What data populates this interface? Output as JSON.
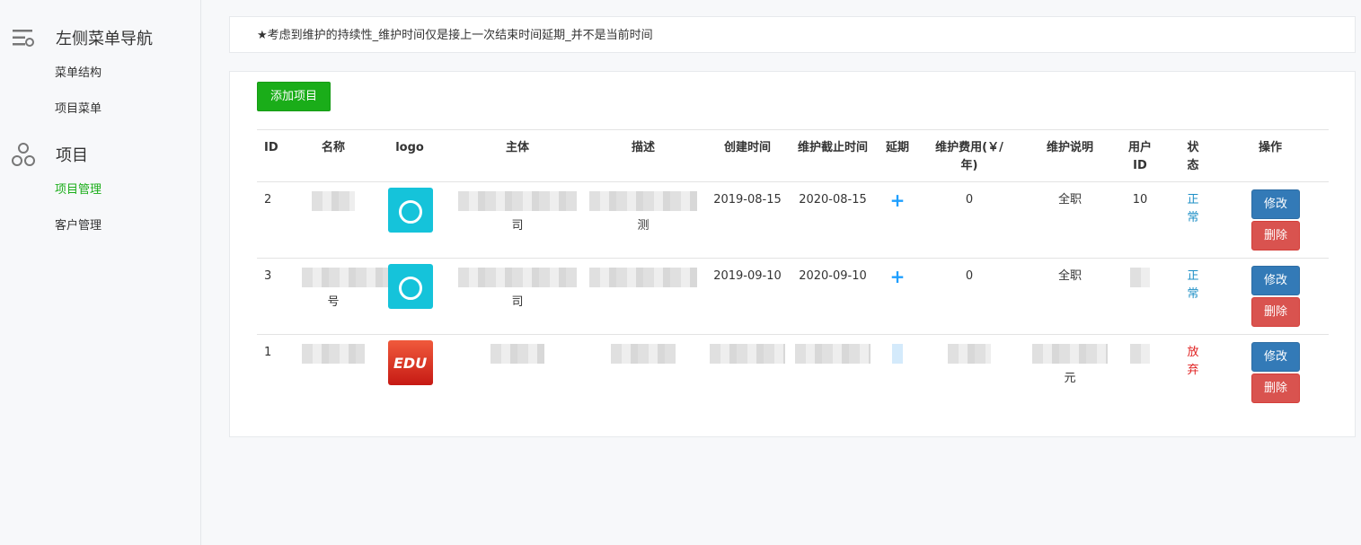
{
  "sidebar": {
    "nav_title": "左侧菜单导航",
    "nav_items": [
      "菜单结构",
      "项目菜单"
    ],
    "project_title": "项目",
    "project_items": [
      "项目管理",
      "客户管理"
    ]
  },
  "notice": "★考虑到维护的持续性_维护时间仅是接上一次结束时间延期_并不是当前时间",
  "toolbar": {
    "add_label": "添加项目"
  },
  "table": {
    "headers": {
      "id": "ID",
      "name": "名称",
      "logo": "logo",
      "main": "主体",
      "desc": "描述",
      "ctime": "创建时间",
      "etime": "维护截止时间",
      "ext": "延期",
      "fee": "维护费用(￥/年)",
      "note": "维护说明",
      "uid": "用户ID",
      "status": "状态",
      "op": "操作"
    },
    "rows": [
      {
        "id": "2",
        "name": "",
        "main": "司",
        "desc": "测",
        "ctime": "2019-08-15",
        "etime": "2020-08-15",
        "ext": "+",
        "fee": "0",
        "note": "全职",
        "uid": "10",
        "status": "正常",
        "edit": "修改",
        "del": "删除"
      },
      {
        "id": "3",
        "name": "号",
        "main": "司",
        "desc": "",
        "ctime": "2019-09-10",
        "etime": "2020-09-10",
        "ext": "+",
        "fee": "0",
        "note": "全职",
        "uid": "",
        "status": "正常",
        "edit": "修改",
        "del": "删除"
      },
      {
        "id": "1",
        "name": "",
        "main": "",
        "desc": "",
        "ctime": "",
        "etime": "",
        "ext": "",
        "fee": "",
        "note": "元",
        "uid": "",
        "status": "放弃",
        "edit": "修改",
        "del": "删除"
      }
    ]
  },
  "colors": {
    "accent": "#1aad19",
    "edit": "#337ab7",
    "delete": "#d9534f",
    "ok": "#1e8fc6",
    "quit": "#e02020"
  }
}
